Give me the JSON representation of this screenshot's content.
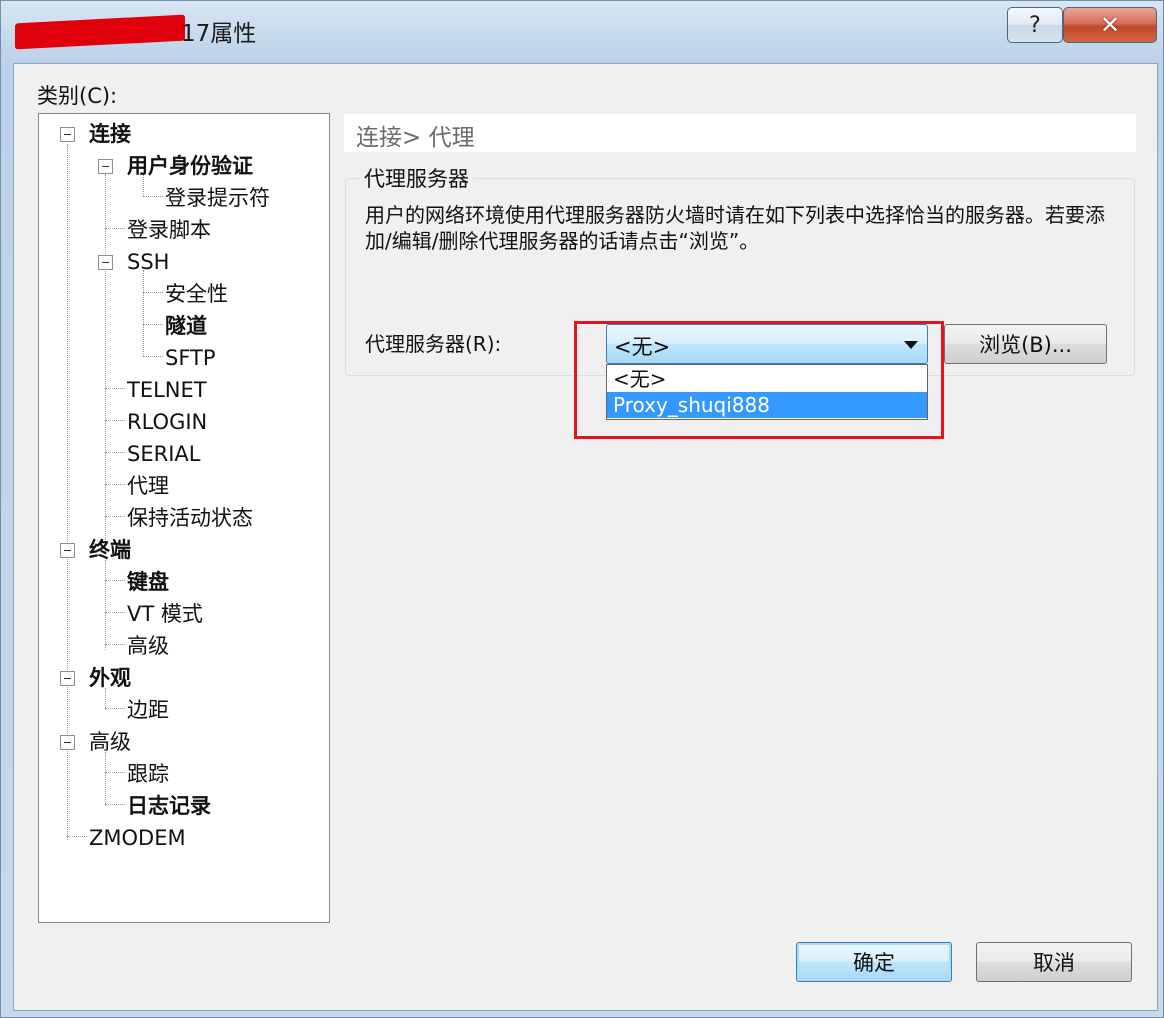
{
  "window": {
    "title": "17属性",
    "help_label": "?",
    "close_label": "✕"
  },
  "category_label": "类别(C):",
  "tree": {
    "n_connect": "连接",
    "n_auth": "用户身份验证",
    "n_login_prompt": "登录提示符",
    "n_login_script": "登录脚本",
    "n_ssh": "SSH",
    "n_security": "安全性",
    "n_tunnel": "隧道",
    "n_sftp": "SFTP",
    "n_telnet": "TELNET",
    "n_rlogin": "RLOGIN",
    "n_serial": "SERIAL",
    "n_proxy": "代理",
    "n_keepalive": "保持活动状态",
    "n_terminal": "终端",
    "n_keyboard": "键盘",
    "n_vt": "VT 模式",
    "n_term_adv": "高级",
    "n_appearance": "外观",
    "n_margin": "边距",
    "n_advanced": "高级",
    "n_trace": "跟踪",
    "n_logging": "日志记录",
    "n_zmodem": "ZMODEM"
  },
  "page": {
    "breadcrumb": "连接> 代理",
    "group_title": "代理服务器",
    "description": "用户的网络环境使用代理服务器防火墙时请在如下列表中选择恰当的服务器。若要添加/编辑/删除代理服务器的话请点击“浏览”。",
    "proxy_label": "代理服务器(R):",
    "proxy_selected": "<无>",
    "proxy_options": [
      "<无>",
      "Proxy_shuqi888"
    ],
    "browse_label": "浏览(B)..."
  },
  "footer": {
    "ok_label": "确定",
    "cancel_label": "取消"
  },
  "colors": {
    "highlight_box": "#e2151e",
    "selection": "#3399ff"
  }
}
